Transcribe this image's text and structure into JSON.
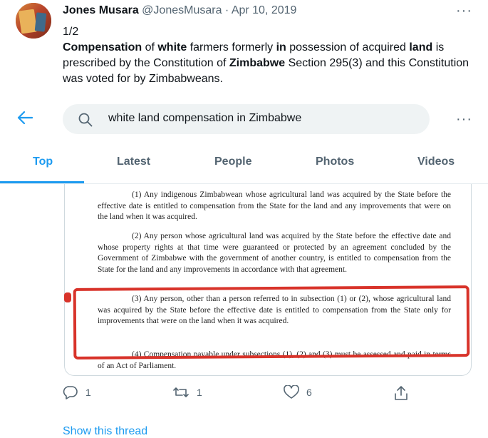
{
  "tweet": {
    "author_name": "Jones Musara",
    "author_handle": "@JonesMusara",
    "separator": "·",
    "date": "Apr 10, 2019",
    "more_icon": "more-dots-icon",
    "thread_index": "1/2",
    "text_parts": [
      {
        "t": "Compensation",
        "b": true
      },
      {
        "t": " of ",
        "b": false
      },
      {
        "t": "white",
        "b": true
      },
      {
        "t": " farmers formerly ",
        "b": false
      },
      {
        "t": "in",
        "b": true
      },
      {
        "t": " possession of acquired ",
        "b": false
      },
      {
        "t": "land",
        "b": true
      },
      {
        "t": " is prescribed by the Constitution of ",
        "b": false
      },
      {
        "t": "Zimbabwe",
        "b": true
      },
      {
        "t": " Section 295(3) and this Constitution was voted for by Zimbabweans.",
        "b": false
      }
    ]
  },
  "search": {
    "back_icon": "back-arrow-icon",
    "search_icon": "search-icon",
    "query": "white land compensation in Zimbabwe",
    "more_icon": "more-dots-icon"
  },
  "tabs": [
    {
      "label": "Top",
      "active": true
    },
    {
      "label": "Latest",
      "active": false
    },
    {
      "label": "People",
      "active": false
    },
    {
      "label": "Photos",
      "active": false
    },
    {
      "label": "Videos",
      "active": false
    }
  ],
  "document": {
    "paragraphs": [
      "(1) Any indigenous Zimbabwean whose agricultural land was acquired by the State before the effective date is entitled to compensation from the State for the land and any improvements that were on the land when it was acquired.",
      "(2) Any person whose agricultural land was acquired by the State before the effective date and whose property rights at that time were guaranteed or protected by an agreement concluded by the Government of Zimbabwe with the government of another country, is entitled to compensation from the State for the land and any improvements in accordance with that agreement.",
      "(3) Any person, other than a person referred to in subsection (1) or (2), whose agricultural land was acquired by the State before the effective date is entitled to compensation from the State only for improvements that were on the land when it was acquired.",
      "(4) Compensation payable under subsections (1), (2) and (3) must be assessed and paid in terms of an Act of Parliament."
    ],
    "highlight_color": "#d8332a"
  },
  "actions": {
    "reply_count": "1",
    "retweet_count": "1",
    "like_count": "6",
    "reply_icon": "reply-icon",
    "retweet_icon": "retweet-icon",
    "like_icon": "heart-icon",
    "share_icon": "share-icon"
  },
  "show_thread": "Show this thread",
  "colors": {
    "accent": "#1d9bf0",
    "muted": "#536471",
    "text": "#0f1419"
  }
}
